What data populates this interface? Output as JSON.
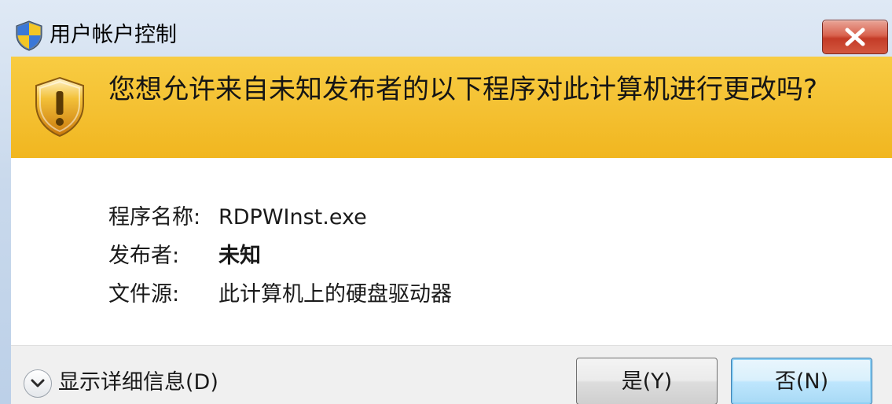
{
  "window": {
    "title": "用户帐户控制",
    "title_icon": "uac-shield-icon",
    "close_icon": "close-icon"
  },
  "banner": {
    "icon": "warning-shield-icon",
    "question": "您想允许来自未知发布者的以下程序对此计算机进行更改吗?"
  },
  "info": {
    "program_name_label": "程序名称:",
    "program_name_value": "RDPWInst.exe",
    "publisher_label": "发布者:",
    "publisher_value": "未知",
    "file_origin_label": "文件源:",
    "file_origin_value": "此计算机上的硬盘驱动器"
  },
  "footer": {
    "details_icon": "chevron-down-icon",
    "details_label": "显示详细信息(D)",
    "yes_label": "是(Y)",
    "no_label": "否(N)"
  },
  "colors": {
    "banner": "#f4c031",
    "title_gradient_top": "#dfe9f5",
    "close_button": "#c43b27",
    "default_button_border": "#3c7fb1"
  }
}
